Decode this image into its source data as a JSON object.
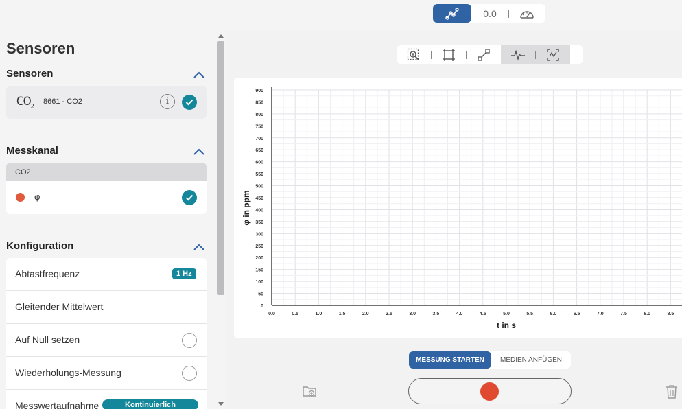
{
  "topbar": {
    "value_display": "0.0"
  },
  "sidebar": {
    "title": "Sensoren",
    "sensors_section": {
      "title": "Sensoren",
      "sensor_icon_main": "CO",
      "sensor_icon_sub": "2",
      "sensor_name": "8661 - CO2",
      "info_symbol": "i"
    },
    "channel_section": {
      "title": "Messkanal",
      "header": "CO2",
      "channel_label": "φ",
      "channel_color": "#e05a3e"
    },
    "config_section": {
      "title": "Konfiguration",
      "rows": [
        {
          "label": "Abtastfrequenz",
          "badge": "1 Hz"
        },
        {
          "label": "Gleitender Mittelwert"
        },
        {
          "label": "Auf Null setzen"
        },
        {
          "label": "Wiederholungs-Messung"
        },
        {
          "label": "Messwertaufnahme",
          "badge": "Kontinuierlich"
        }
      ]
    }
  },
  "controls": {
    "start_label": "MESSUNG STARTEN",
    "media_label": "MEDIEN ANFÜGEN"
  },
  "colors": {
    "accent": "#2f63a4",
    "teal": "#14879a",
    "record": "#e04a30"
  },
  "chart_data": {
    "type": "line",
    "xlabel": "t in s",
    "ylabel": "φ in ppm",
    "x_ticks": [
      "0.0",
      "0.5",
      "1.0",
      "1.5",
      "2.0",
      "2.5",
      "3.0",
      "3.5",
      "4.0",
      "4.5",
      "5.0",
      "5.5",
      "6.0",
      "6.5",
      "7.0",
      "7.5",
      "8.0",
      "8.5"
    ],
    "y_ticks": [
      "0",
      "50",
      "100",
      "150",
      "200",
      "250",
      "300",
      "350",
      "400",
      "450",
      "500",
      "550",
      "600",
      "650",
      "700",
      "750",
      "800",
      "850",
      "900"
    ],
    "xlim": [
      0,
      8.5
    ],
    "ylim": [
      0,
      900
    ],
    "grid": true,
    "series": []
  }
}
